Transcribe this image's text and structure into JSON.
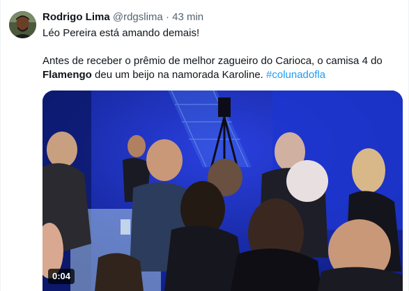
{
  "tweet": {
    "author_name": "Rodrigo Lima",
    "author_handle": "@rdgslima",
    "separator": "·",
    "timestamp": "43 min",
    "line1": "Léo Pereira está amando demais!",
    "line2_part1": "Antes de receber o prêmio de melhor zagueiro do Carioca, o camisa 4 do",
    "line2_bold": "Flamengo",
    "line2_part2": " deu um beijo na namorada Karoline. ",
    "hashtag": "#colunadofla"
  },
  "video": {
    "duration": "0:04"
  },
  "colors": {
    "hashtag": "#1d9bf0",
    "text": "#0f1419",
    "secondary": "#536471"
  }
}
